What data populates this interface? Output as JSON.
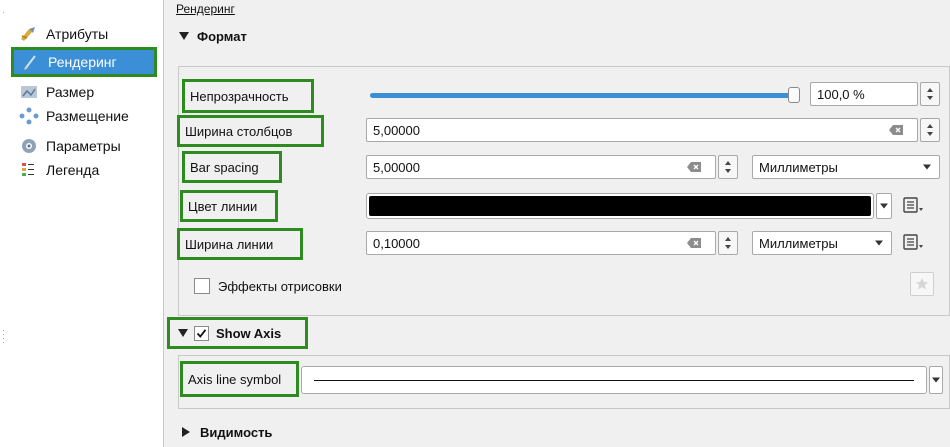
{
  "sidebar": {
    "items": [
      {
        "label": "Атрибуты",
        "icon": "attributes-icon",
        "selected": false
      },
      {
        "label": "Рендеринг",
        "icon": "rendering-icon",
        "selected": true
      },
      {
        "label": "Размер",
        "icon": "size-icon",
        "selected": false
      },
      {
        "label": "Размещение",
        "icon": "placement-icon",
        "selected": false
      },
      {
        "label": "Параметры",
        "icon": "options-icon",
        "selected": false
      },
      {
        "label": "Легенда",
        "icon": "legend-icon",
        "selected": false
      }
    ]
  },
  "page": {
    "breadcrumb": "Рендеринг"
  },
  "format_group": {
    "title": "Формат",
    "opacity": {
      "label": "Непрозрачность",
      "value": "100,0 %",
      "level": 1.0
    },
    "bar_width": {
      "label": "Ширина столбцов",
      "value": "5,00000"
    },
    "bar_spacing": {
      "label": "Bar spacing",
      "value": "5,00000",
      "unit": "Миллиметры"
    },
    "line_color": {
      "label": "Цвет линии",
      "color": "#000000"
    },
    "line_width": {
      "label": "Ширина линии",
      "value": "0,10000",
      "unit": "Миллиметры"
    },
    "effects": {
      "label": "Эффекты отрисовки",
      "checked": false
    }
  },
  "axis_group": {
    "title": "Show Axis",
    "checked": true,
    "line_symbol_label": "Axis line symbol"
  },
  "visibility_group": {
    "title": "Видимость"
  },
  "colors": {
    "highlight": "#2e8b1f",
    "selection": "#3a8fd6",
    "slider": "#3a8fd6"
  }
}
